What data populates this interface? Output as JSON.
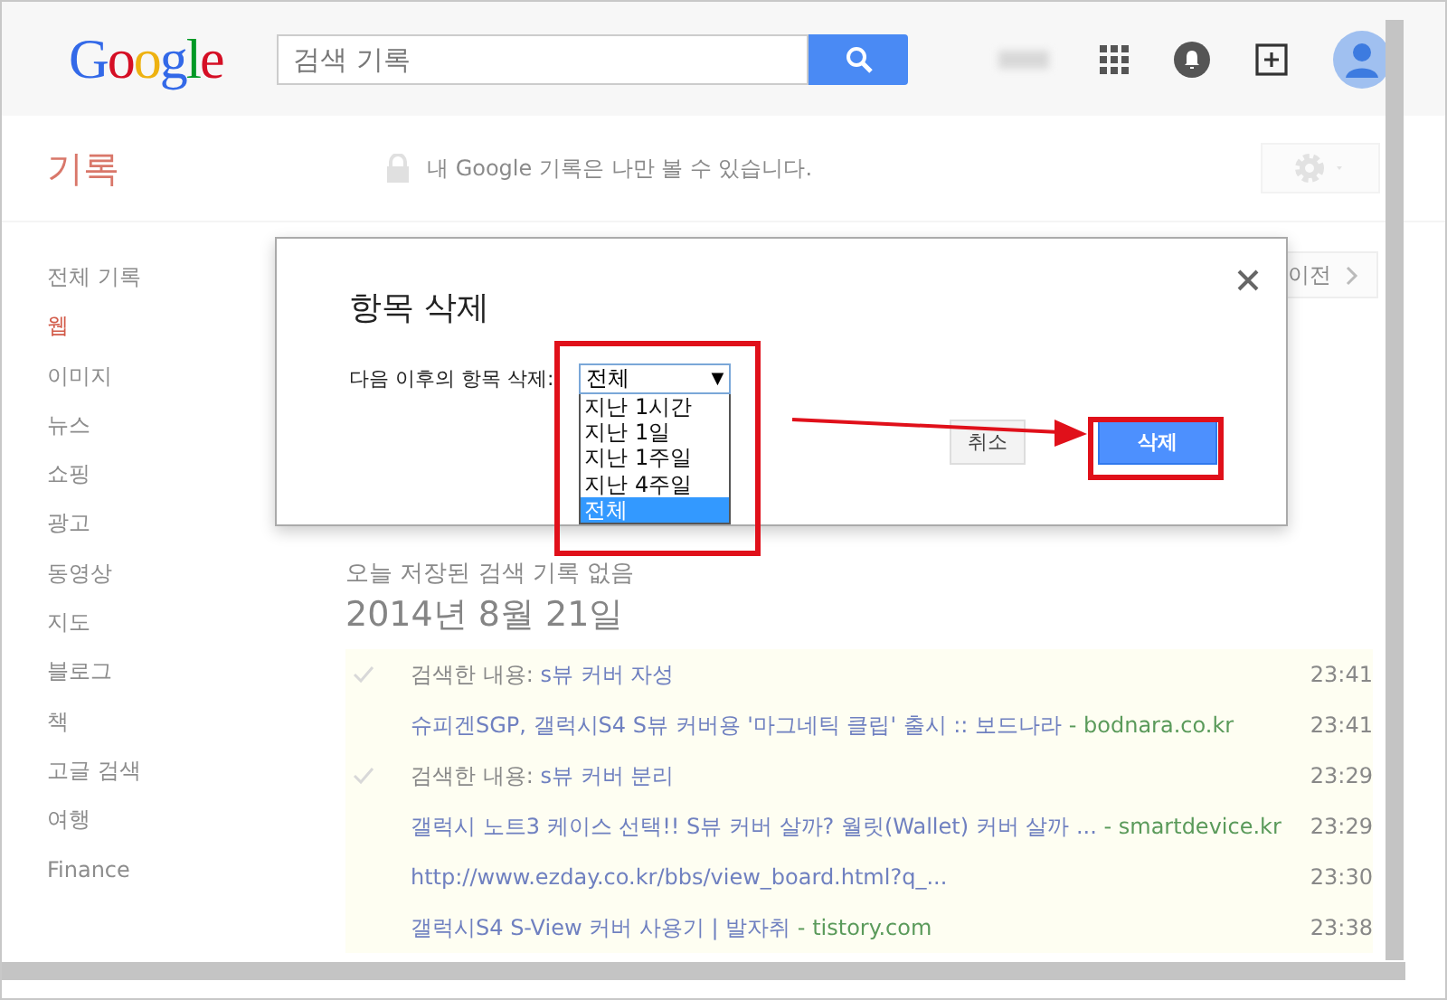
{
  "header": {
    "logo": "Google",
    "search": {
      "placeholder": "검색 기록"
    }
  },
  "page": {
    "title": "기록",
    "privacy_note": "내 Google 기록은 나만 볼 수 있습니다.",
    "prev_button": "이전",
    "nav": [
      {
        "label": "전체 기록",
        "selected": false
      },
      {
        "label": "웹",
        "selected": true
      },
      {
        "label": "이미지",
        "selected": false
      },
      {
        "label": "뉴스",
        "selected": false
      },
      {
        "label": "쇼핑",
        "selected": false
      },
      {
        "label": "광고",
        "selected": false
      },
      {
        "label": "동영상",
        "selected": false
      },
      {
        "label": "지도",
        "selected": false
      },
      {
        "label": "블로그",
        "selected": false
      },
      {
        "label": "책",
        "selected": false
      },
      {
        "label": "고글 검색",
        "selected": false
      },
      {
        "label": "여행",
        "selected": false
      },
      {
        "label": "Finance",
        "selected": false
      }
    ],
    "no_history_note": "오늘 저장된 검색 기록 없음",
    "date_heading": "2014년 8월 21일",
    "entries": [
      {
        "kind": "search",
        "label": "검색한 내용:",
        "text": "s뷰 커버 자성",
        "time": "23:41"
      },
      {
        "kind": "visit",
        "text": "슈피겐SGP, 갤럭시S4 S뷰 커버용 '마그네틱 클립' 출시 :: 보드나라",
        "domain": "- bodnara.co.kr",
        "time": "23:41"
      },
      {
        "kind": "search",
        "label": "검색한 내용:",
        "text": "s뷰 커버 분리",
        "time": "23:29"
      },
      {
        "kind": "visit",
        "text": "갤럭시 노트3 케이스 선택!! S뷰 커버 살까? 월릿(Wallet) 커버 살까 ...",
        "domain": "- smartdevice.kr",
        "time": "23:29"
      },
      {
        "kind": "visit",
        "text": "http://www.ezday.co.kr/bbs/view_board.html?q_...",
        "time": "23:30"
      },
      {
        "kind": "visit",
        "text": "갤럭시S4 S-View 커버 사용기 | 발자취",
        "domain": "- tistory.com",
        "time": "23:38"
      }
    ]
  },
  "dialog": {
    "title": "항목 삭제",
    "label": "다음 이후의 항목 삭제:",
    "select": {
      "value": "전체",
      "arrow": "▼"
    },
    "options": [
      {
        "label": "지난 1시간",
        "selected": false
      },
      {
        "label": "지난 1일",
        "selected": false
      },
      {
        "label": "지난 1주일",
        "selected": false
      },
      {
        "label": "지난 4주일",
        "selected": false
      },
      {
        "label": "전체",
        "selected": true
      }
    ],
    "cancel_button": "취소",
    "delete_button": "삭제"
  }
}
